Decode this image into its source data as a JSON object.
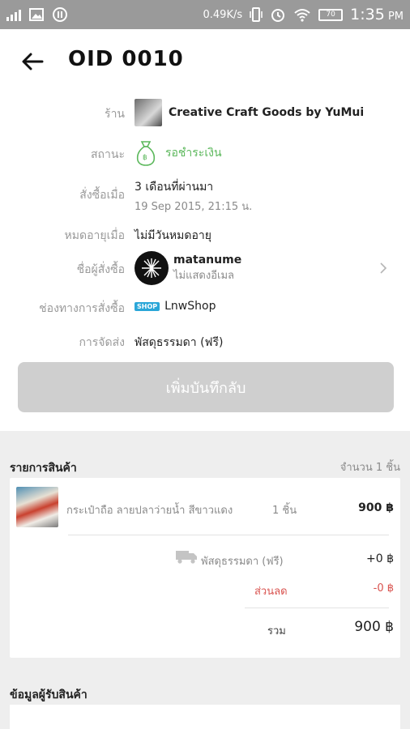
{
  "status_bar": {
    "net_speed": "0.49K/s",
    "battery": "70",
    "time": "1:35",
    "ampm": "PM"
  },
  "header": {
    "title": "OID  0010"
  },
  "info": {
    "shop_label": "ร้าน",
    "shop_name": "Creative Craft Goods by YuMui",
    "status_label": "สถานะ",
    "status_value": "รอชำระเงิน",
    "ordered_label": "สั่งซื้อเมื่อ",
    "ordered_relative": "3 เดือนที่ผ่านมา",
    "ordered_date": "19 Sep 2015, 21:15 น.",
    "expire_label": "หมดอายุเมื่อ",
    "expire_value": "ไม่มีวันหมดอายุ",
    "buyer_label": "ชื่อผู้สั่งซื้อ",
    "buyer_name": "matanume",
    "buyer_email": "ไม่แสดงอีเมล",
    "channel_label": "ช่องทางการสั่งซื้อ",
    "channel_badge": "SHOP",
    "channel_value": "LnwShop",
    "shipping_label": "การจัดส่ง",
    "shipping_value": "พัสดุธรรมดา (ฟรี)"
  },
  "add_note_button": "เพิ่มบันทึกลับ",
  "products": {
    "title": "รายการสินค้า",
    "count": "จำนวน 1 ชิ้น",
    "items": [
      {
        "name": "กระเป๋าถือ ลายปลาว่ายน้ำ สีขาวแดง",
        "qty": "1 ชิ้น",
        "price": "900 ฿"
      }
    ],
    "shipping_name": "พัสดุธรรมดา (ฟรี)",
    "shipping_amount": "+0 ฿",
    "discount_label": "ส่วนลด",
    "discount_amount": "-0 ฿",
    "total_label": "รวม",
    "total_amount": "900 ฿"
  },
  "recipient": {
    "title": "ข้อมูลผู้รับสินค้า"
  },
  "colors": {
    "accent_green": "#5cb85c",
    "discount_red": "#d9534f",
    "button_gray": "#cfcfcf"
  }
}
